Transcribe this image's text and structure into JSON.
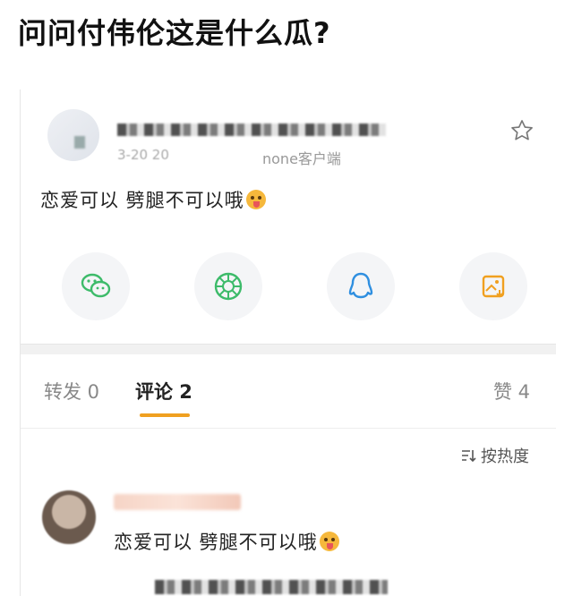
{
  "headline": "问问付伟伦这是什么瓜?",
  "post": {
    "time": "3-20 20",
    "client": "none客户端",
    "text": "恋爱可以 劈腿不可以哦"
  },
  "share": {
    "items": [
      "wechat-icon",
      "moments-icon",
      "qq-icon",
      "save-image-icon"
    ],
    "colors": {
      "green": "#3dbb6a",
      "blue": "#2f8fe0",
      "orange": "#f0a020"
    }
  },
  "tabs": {
    "repost": "转发 0",
    "comments": "评论 2",
    "likes": "赞 4"
  },
  "sort": {
    "label": "按热度"
  },
  "comment": {
    "text": "恋爱可以 劈腿不可以哦"
  }
}
